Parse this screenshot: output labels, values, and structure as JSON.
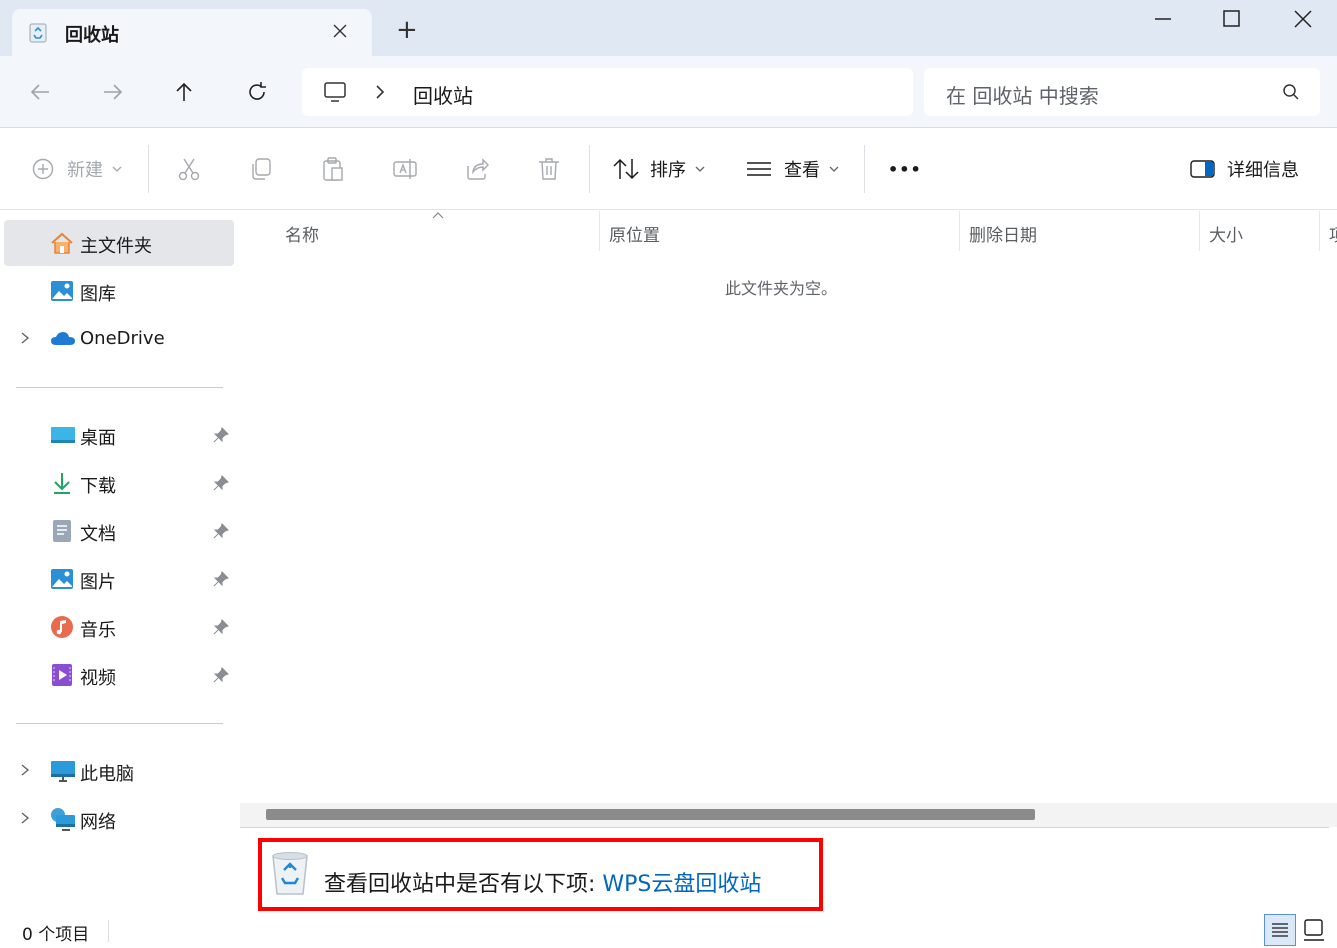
{
  "window": {
    "tab_title": "回收站",
    "new_tab_symbol": "+"
  },
  "nav": {
    "address_path": "回收站",
    "search_placeholder": "在 回收站 中搜索"
  },
  "toolbar": {
    "new_label": "新建",
    "sort_label": "排序",
    "view_label": "查看",
    "more_label": "•••",
    "details_label": "详细信息"
  },
  "sidebar": {
    "items": [
      {
        "label": "主文件夹",
        "icon": "home-icon"
      },
      {
        "label": "图库",
        "icon": "gallery-icon"
      },
      {
        "label": "OneDrive",
        "icon": "cloud-icon"
      },
      {
        "label": "桌面",
        "icon": "desktop-icon"
      },
      {
        "label": "下载",
        "icon": "download-icon"
      },
      {
        "label": "文档",
        "icon": "document-icon"
      },
      {
        "label": "图片",
        "icon": "pictures-icon"
      },
      {
        "label": "音乐",
        "icon": "music-icon"
      },
      {
        "label": "视频",
        "icon": "video-icon"
      },
      {
        "label": "此电脑",
        "icon": "computer-icon"
      },
      {
        "label": "网络",
        "icon": "network-icon"
      }
    ]
  },
  "columns": [
    "名称",
    "原位置",
    "删除日期",
    "大小",
    "项"
  ],
  "empty_message": "此文件夹为空。",
  "banner": {
    "text": "查看回收站中是否有以下项: ",
    "link": "WPS云盘回收站"
  },
  "status": {
    "item_count": "0 个项目"
  },
  "colors": {
    "accent": "#0067c0",
    "highlight_border": "#ff0000",
    "titlebar_bg": "#dfe8f3"
  }
}
